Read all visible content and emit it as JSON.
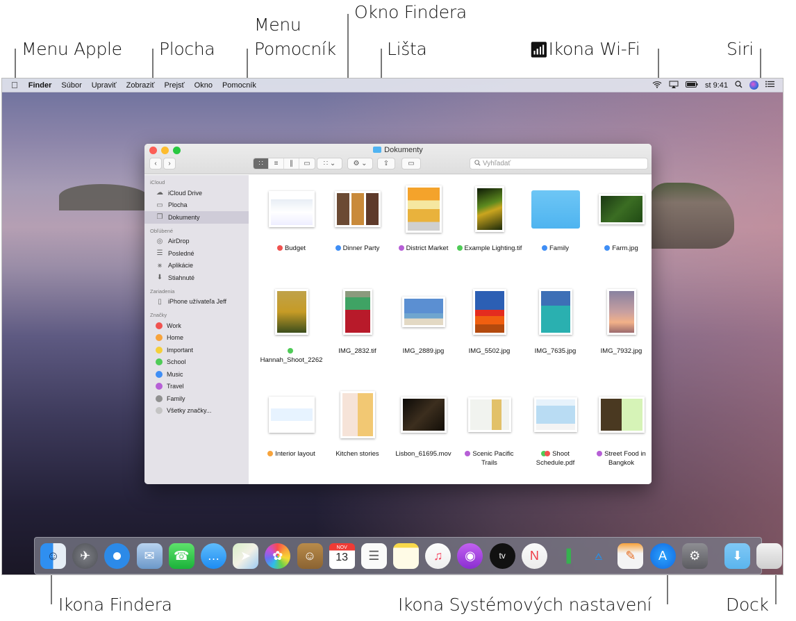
{
  "callouts": {
    "apple_menu": "Menu Apple",
    "desktop": "Plocha",
    "help_menu_line1": "Menu",
    "help_menu_line2": "Pomocník",
    "finder_window": "Okno Findera",
    "menu_bar": "Lišta",
    "wifi_icon": "Ikona Wi-Fi",
    "siri": "Siri",
    "finder_icon": "Ikona Findera",
    "system_prefs_icon": "Ikona Systémových nastavení",
    "dock": "Dock"
  },
  "menubar": {
    "items": [
      "Finder",
      "Súbor",
      "Upraviť",
      "Zobraziť",
      "Prejsť",
      "Okno",
      "Pomocník"
    ],
    "clock": "st 9:41"
  },
  "finder": {
    "title": "Dokumenty",
    "search_placeholder": "Vyhľadať",
    "view_modes": [
      "icon",
      "list",
      "columns",
      "gallery"
    ],
    "active_view": "icon",
    "sidebar": {
      "sections": [
        {
          "header": "iCloud",
          "items": [
            {
              "label": "iCloud Drive",
              "icon": "cloud-icon"
            },
            {
              "label": "Plocha",
              "icon": "desktop-icon"
            },
            {
              "label": "Dokumenty",
              "icon": "documents-icon",
              "selected": true
            }
          ]
        },
        {
          "header": "Obľúbené",
          "items": [
            {
              "label": "AirDrop",
              "icon": "airdrop-icon"
            },
            {
              "label": "Posledné",
              "icon": "recents-icon"
            },
            {
              "label": "Aplikácie",
              "icon": "applications-icon"
            },
            {
              "label": "Stiahnuté",
              "icon": "downloads-icon"
            }
          ]
        },
        {
          "header": "Zariadenia",
          "items": [
            {
              "label": "iPhone užívateľa Jeff",
              "icon": "iphone-icon"
            }
          ]
        },
        {
          "header": "Značky",
          "items": [
            {
              "label": "Work",
              "color": "#f0524f"
            },
            {
              "label": "Home",
              "color": "#f7a33b"
            },
            {
              "label": "Important",
              "color": "#f5cf3a"
            },
            {
              "label": "School",
              "color": "#4fcb57"
            },
            {
              "label": "Music",
              "color": "#3f8ef5"
            },
            {
              "label": "Travel",
              "color": "#b65fd6"
            },
            {
              "label": "Family",
              "color": "#909090"
            },
            {
              "label": "Všetky značky...",
              "color": "#c4c4c4"
            }
          ]
        }
      ]
    },
    "files": [
      {
        "name": "Budget",
        "tags": [
          "#f0524f"
        ]
      },
      {
        "name": "Dinner Party",
        "tags": [
          "#3f8ef5"
        ]
      },
      {
        "name": "District Market",
        "tags": [
          "#b65fd6"
        ]
      },
      {
        "name": "Example Lighting.tif",
        "tags": [
          "#4fcb57"
        ]
      },
      {
        "name": "Family",
        "tags": [
          "#3f8ef5"
        ]
      },
      {
        "name": "Farm.jpg",
        "tags": [
          "#3f8ef5"
        ]
      },
      {
        "name": "Hannah_Shoot_2262",
        "tags": [
          "#4fcb57"
        ]
      },
      {
        "name": "IMG_2832.tif",
        "tags": []
      },
      {
        "name": "IMG_2889.jpg",
        "tags": []
      },
      {
        "name": "IMG_5502.jpg",
        "tags": []
      },
      {
        "name": "IMG_7635.jpg",
        "tags": []
      },
      {
        "name": "IMG_7932.jpg",
        "tags": []
      },
      {
        "name": "Interior layout",
        "tags": [
          "#f7a33b"
        ]
      },
      {
        "name": "Kitchen stories",
        "tags": []
      },
      {
        "name": "Lisbon_61695.mov",
        "tags": []
      },
      {
        "name": "Scenic Pacific Trails",
        "tags": [
          "#b65fd6"
        ]
      },
      {
        "name": "Shoot Schedule.pdf",
        "tags": [
          "#4fcb57",
          "#f0524f"
        ]
      },
      {
        "name": "Street Food in Bangkok",
        "tags": [
          "#b65fd6"
        ]
      }
    ]
  },
  "dock": {
    "apps": [
      {
        "name": "Finder",
        "icon": "finder-icon"
      },
      {
        "name": "Launchpad",
        "icon": "launchpad-icon"
      },
      {
        "name": "Safari",
        "icon": "safari-icon"
      },
      {
        "name": "Mail",
        "icon": "mail-icon"
      },
      {
        "name": "FaceTime",
        "icon": "facetime-icon"
      },
      {
        "name": "Messages",
        "icon": "messages-icon"
      },
      {
        "name": "Maps",
        "icon": "maps-icon"
      },
      {
        "name": "Photos",
        "icon": "photos-icon"
      },
      {
        "name": "Contacts",
        "icon": "contacts-icon"
      },
      {
        "name": "Calendar",
        "icon": "calendar-icon",
        "month": "NOV",
        "day": "13"
      },
      {
        "name": "Reminders",
        "icon": "reminders-icon"
      },
      {
        "name": "Notes",
        "icon": "notes-icon"
      },
      {
        "name": "Music",
        "icon": "music-icon"
      },
      {
        "name": "Podcasts",
        "icon": "podcasts-icon"
      },
      {
        "name": "TV",
        "icon": "tv-icon",
        "label": "tv"
      },
      {
        "name": "News",
        "icon": "news-icon"
      },
      {
        "name": "Numbers",
        "icon": "numbers-icon"
      },
      {
        "name": "Keynote",
        "icon": "keynote-icon"
      },
      {
        "name": "Pages",
        "icon": "pages-icon"
      },
      {
        "name": "App Store",
        "icon": "app-store-icon"
      },
      {
        "name": "System Preferences",
        "icon": "system-preferences-icon"
      }
    ],
    "stack": [
      {
        "name": "Downloads",
        "icon": "downloads-folder-icon"
      },
      {
        "name": "Trash",
        "icon": "trash-icon"
      }
    ]
  }
}
